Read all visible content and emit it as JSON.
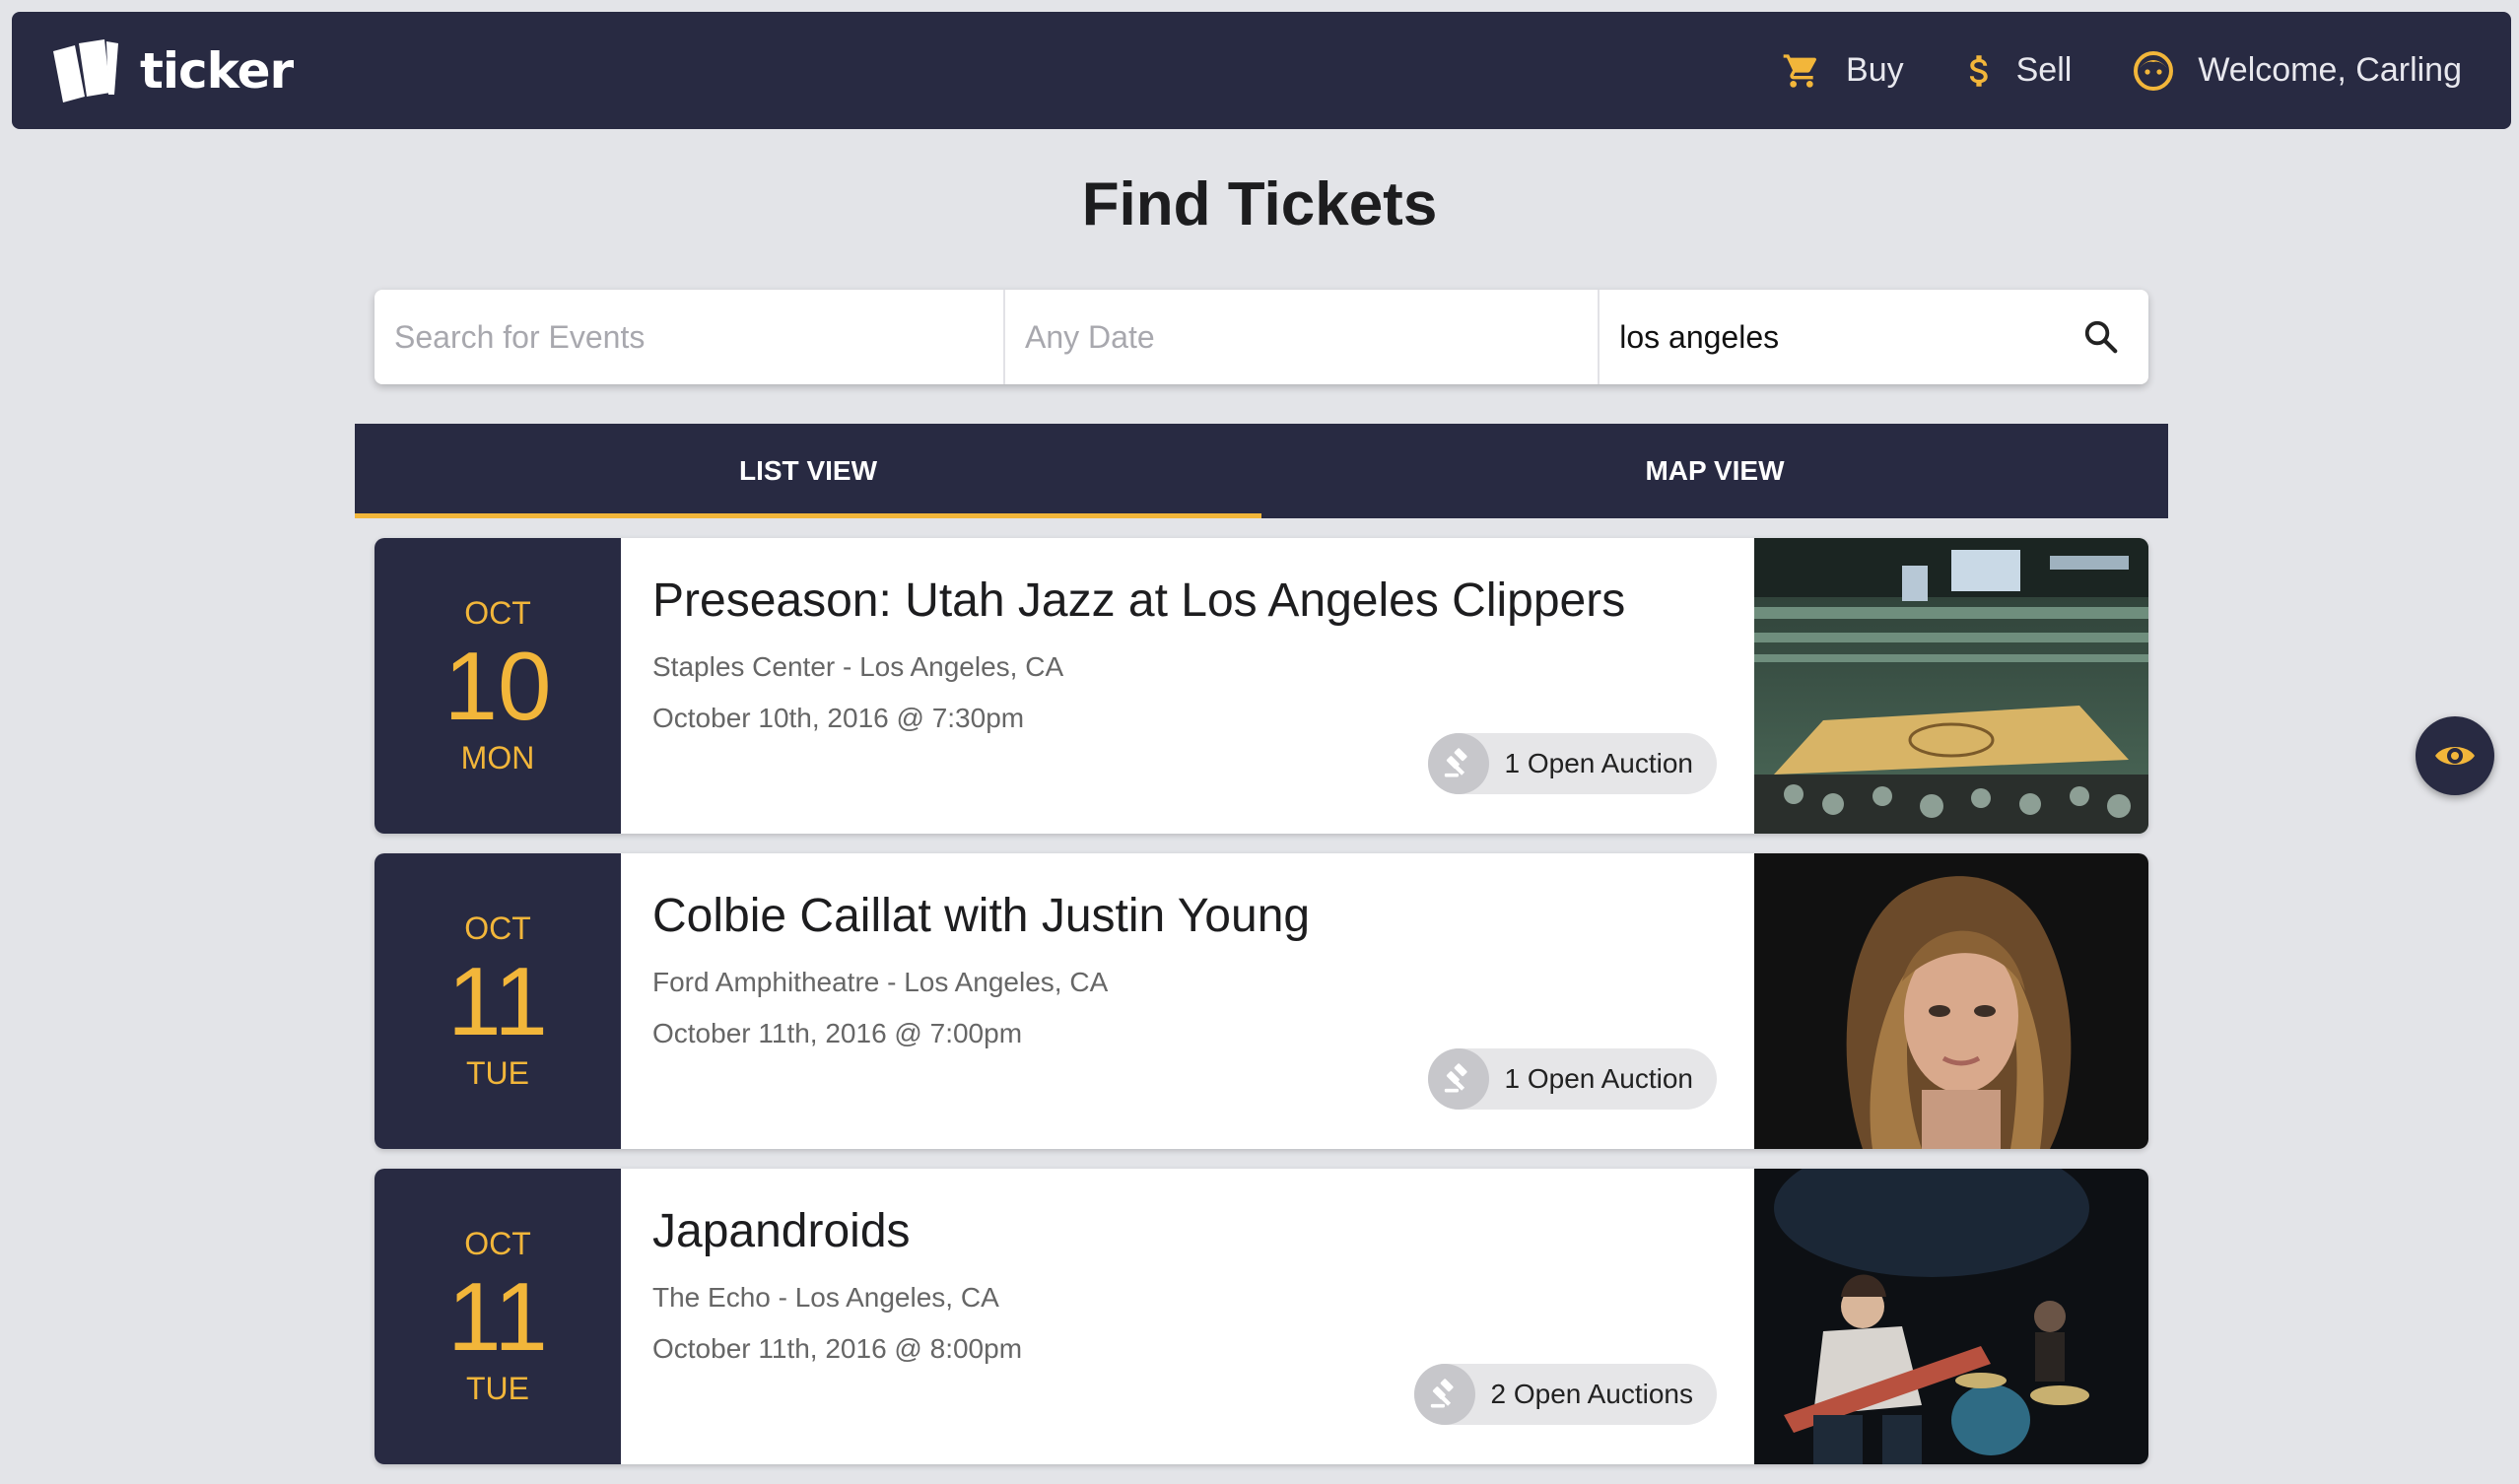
{
  "brand": {
    "name": "ticker"
  },
  "nav": {
    "buy_label": "Buy",
    "sell_label": "Sell",
    "welcome_label": "Welcome, Carling"
  },
  "page": {
    "title": "Find Tickets"
  },
  "search": {
    "events_placeholder": "Search for Events",
    "date_placeholder": "Any Date",
    "location_value": "los angeles"
  },
  "tabs": {
    "list_label": "LIST VIEW",
    "map_label": "MAP VIEW",
    "active": "list"
  },
  "colors": {
    "navy": "#282a42",
    "accent": "#f2b63a",
    "background": "#e3e4e8"
  },
  "events": [
    {
      "month": "OCT",
      "day": "10",
      "weekday": "MON",
      "title": "Preseason: Utah Jazz at Los Angeles Clippers",
      "venue": "Staples Center - Los Angeles, CA",
      "datetime": "October 10th, 2016 @ 7:30pm",
      "auction_label": "1 Open Auction"
    },
    {
      "month": "OCT",
      "day": "11",
      "weekday": "TUE",
      "title": "Colbie Caillat with Justin Young",
      "venue": "Ford Amphitheatre - Los Angeles, CA",
      "datetime": "October 11th, 2016 @ 7:00pm",
      "auction_label": "1 Open Auction"
    },
    {
      "month": "OCT",
      "day": "11",
      "weekday": "TUE",
      "title": "Japandroids",
      "venue": "The Echo - Los Angeles, CA",
      "datetime": "October 11th, 2016 @ 8:00pm",
      "auction_label": "2 Open Auctions"
    }
  ],
  "icons": {
    "buy": "cart-icon",
    "sell": "dollar-icon",
    "user": "smiley-icon",
    "search": "search-icon",
    "auction": "gavel-icon",
    "fab": "eye-icon"
  }
}
